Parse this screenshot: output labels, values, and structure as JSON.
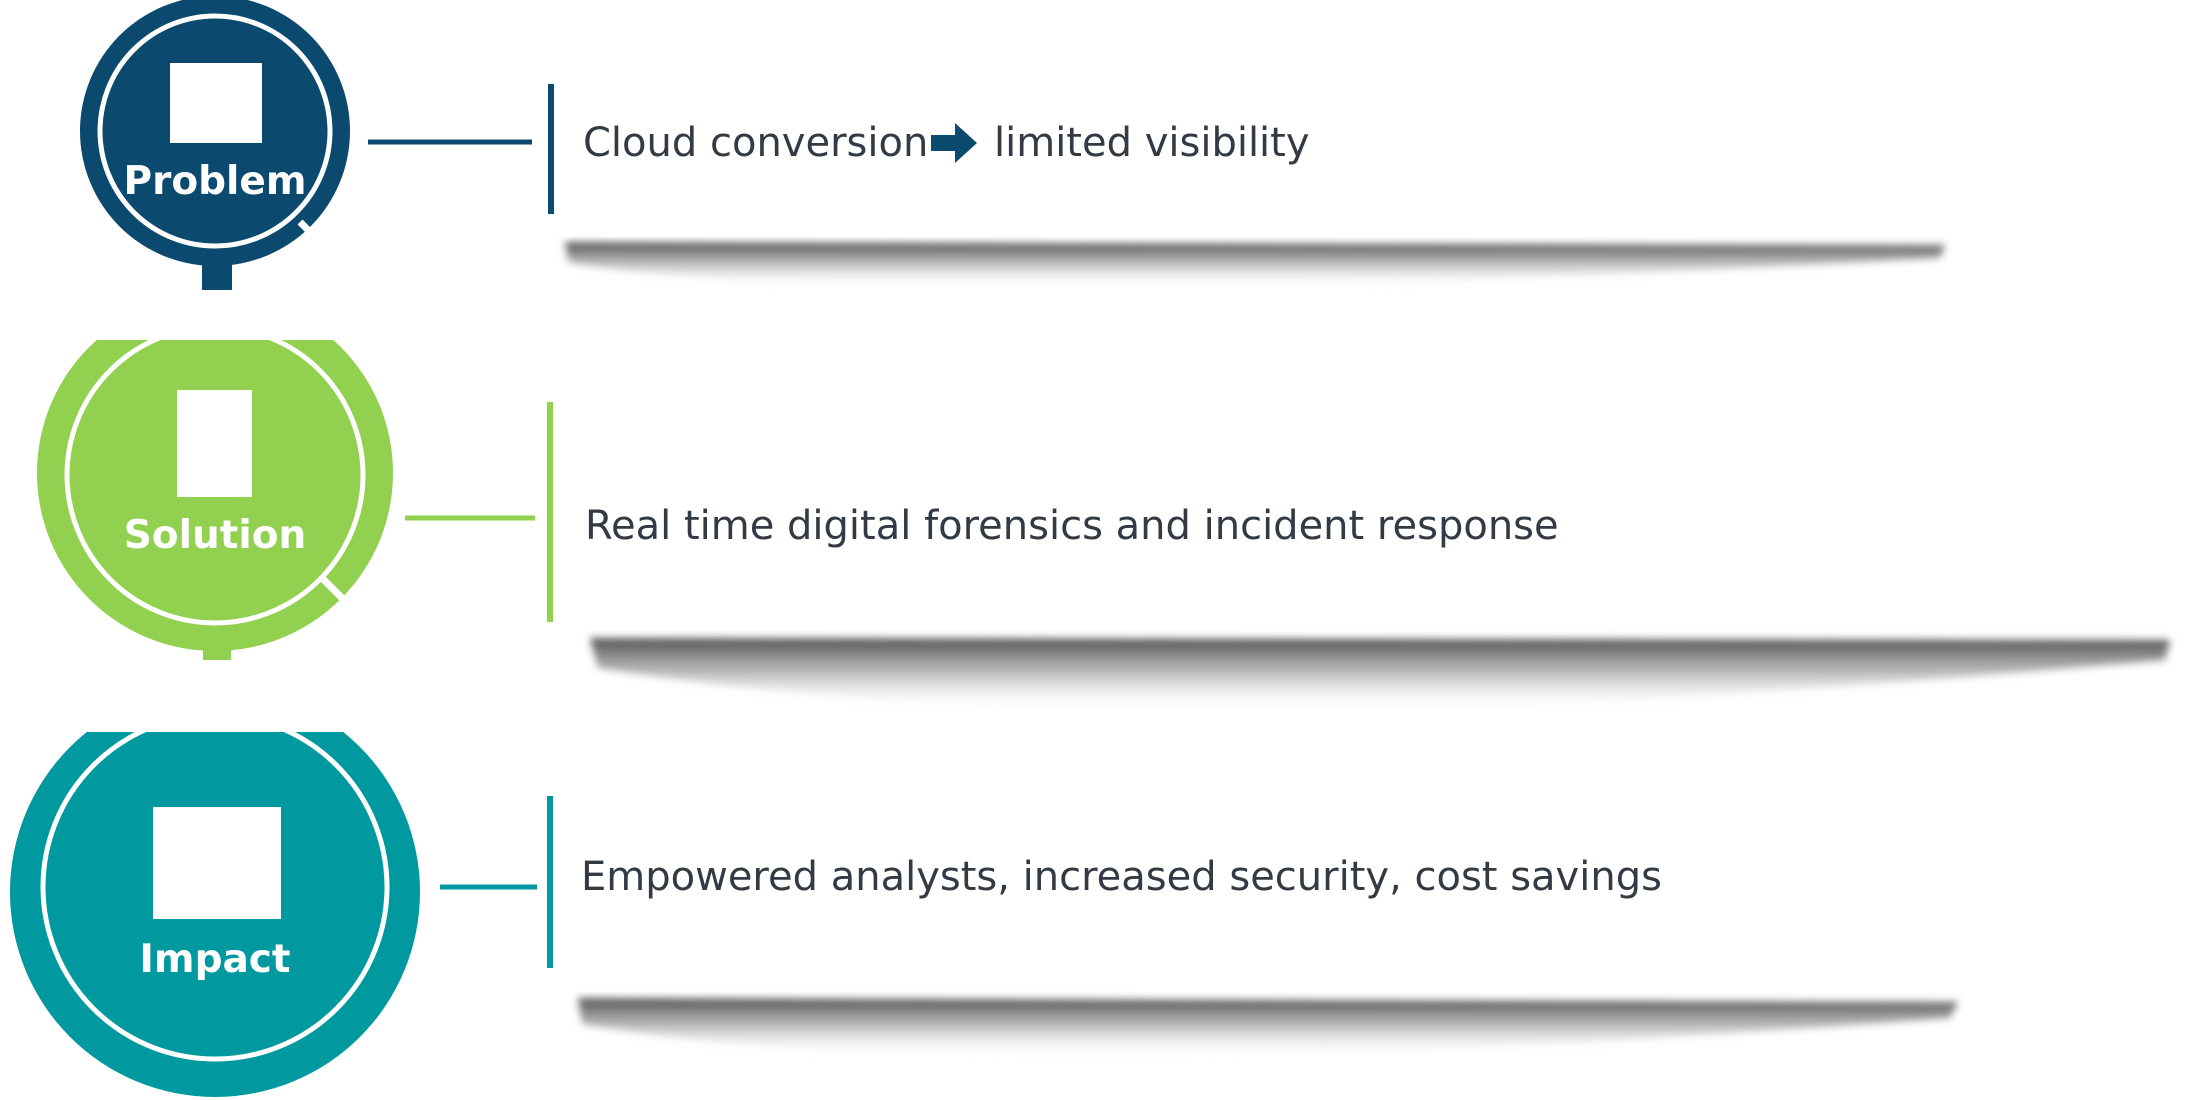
{
  "colors": {
    "problem": "#0b4a6e",
    "solution": "#92d050",
    "impact": "#00999f",
    "text": "#333a44"
  },
  "steps": [
    {
      "label": "Problem",
      "text_before": "Cloud conversion",
      "arrow": "right-arrow-icon",
      "text_after": "limited visibility"
    },
    {
      "label": "Solution",
      "text": "Real time digital forensics and incident response"
    },
    {
      "label": "Impact",
      "text": "Empowered analysts, increased security, cost savings"
    }
  ]
}
